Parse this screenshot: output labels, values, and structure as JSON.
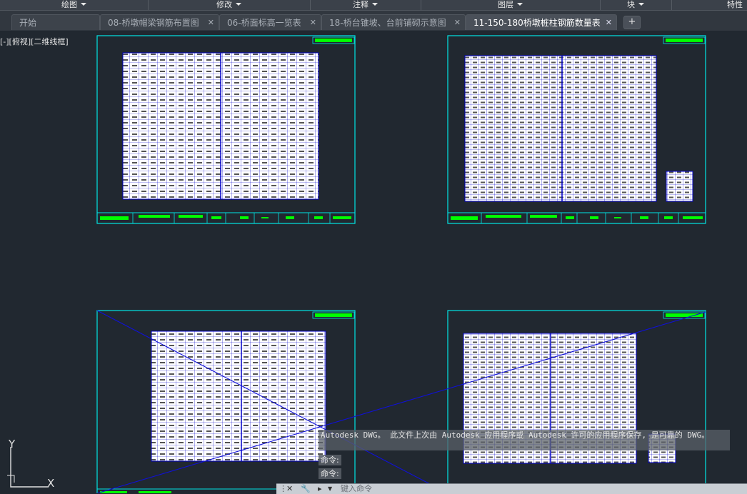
{
  "ribbon": {
    "panels": [
      {
        "label": "绘图",
        "has_arrow": true
      },
      {
        "label": "修改",
        "has_arrow": true
      },
      {
        "label": "注释",
        "has_arrow": true
      },
      {
        "label": "图层",
        "has_arrow": true
      },
      {
        "label": "块",
        "has_arrow": true
      },
      {
        "label": "特性",
        "has_arrow": false
      }
    ]
  },
  "tabs": [
    {
      "label": "开始",
      "closable": false,
      "active": false
    },
    {
      "label": "08-桥墩帽梁钢筋布置图",
      "closable": true,
      "active": false
    },
    {
      "label": "06-桥面标高一览表",
      "closable": true,
      "active": false
    },
    {
      "label": "18-桥台锥坡、台前铺砌示意图",
      "closable": true,
      "active": false
    },
    {
      "label": "11-150-180桥墩桩柱钢筋数量表",
      "closable": true,
      "active": true
    }
  ],
  "new_tab_symbol": "+",
  "viewport_label": "[-][俯视][二维线框]",
  "ucs": {
    "y": "Y",
    "x": "X"
  },
  "command": {
    "history": "Autodesk DWG。  此文件上次由 Autodesk 应用程序或 Autodesk 许可的应用程序保存, 是可靠的 DWG。",
    "prompts": [
      "命令:",
      "命令:"
    ],
    "placeholder": "键入命令"
  },
  "colors": {
    "background": "#212830",
    "sheet_border": "#00e5e5",
    "sheet_paper": "#ffffff",
    "table_border": "#0000c8",
    "title_text": "#00ff00",
    "cross_line": "#1010d8"
  }
}
